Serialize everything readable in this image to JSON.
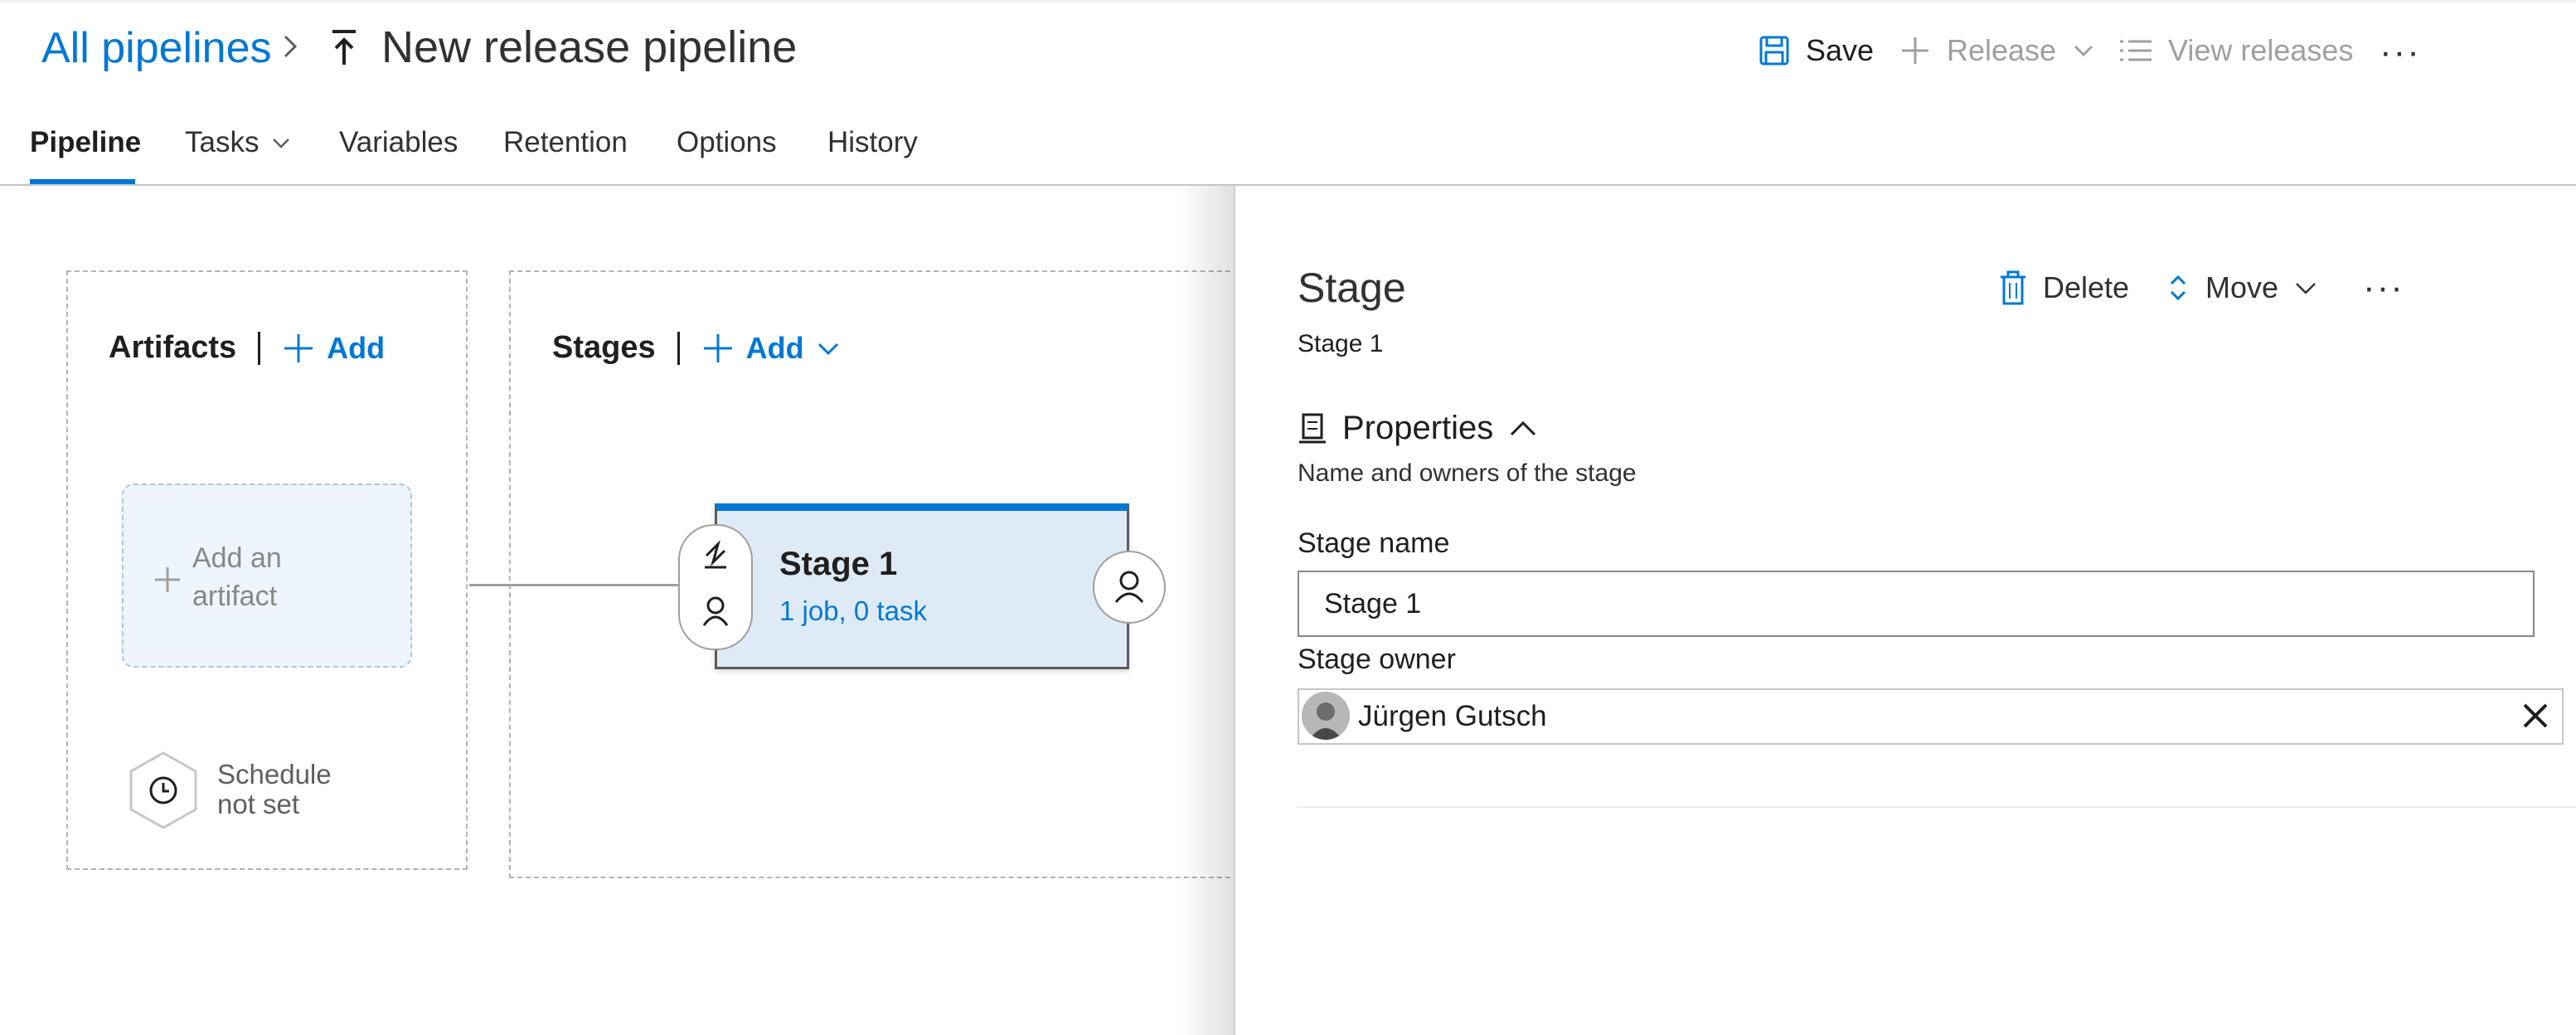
{
  "header": {
    "breadcrumb_link": "All pipelines",
    "title": "New release pipeline",
    "save_label": "Save",
    "release_label": "Release",
    "view_releases_label": "View releases",
    "more_label": "···"
  },
  "tabs": [
    {
      "label": "Pipeline",
      "active": true
    },
    {
      "label": "Tasks",
      "active": false
    },
    {
      "label": "Variables",
      "active": false
    },
    {
      "label": "Retention",
      "active": false
    },
    {
      "label": "Options",
      "active": false
    },
    {
      "label": "History",
      "active": false
    }
  ],
  "canvas": {
    "artifacts_title": "Artifacts",
    "artifacts_add": "Add",
    "add_artifact_line1": "Add an",
    "add_artifact_line2": "artifact",
    "schedule_line1": "Schedule",
    "schedule_line2": "not set",
    "stages_title": "Stages",
    "stages_add": "Add",
    "stage_card": {
      "name": "Stage 1",
      "summary": "1 job, 0 task"
    }
  },
  "panel": {
    "title": "Stage",
    "subtitle": "Stage 1",
    "delete_label": "Delete",
    "move_label": "Move",
    "more_label": "···",
    "properties_title": "Properties",
    "properties_desc": "Name and owners of the stage",
    "stage_name_label": "Stage name",
    "stage_name_value": "Stage 1",
    "stage_owner_label": "Stage owner",
    "stage_owner_name": "Jürgen Gutsch"
  },
  "colors": {
    "accent": "#0078d4",
    "stage_fill": "#deebf7",
    "disabled": "#a19f9d"
  }
}
